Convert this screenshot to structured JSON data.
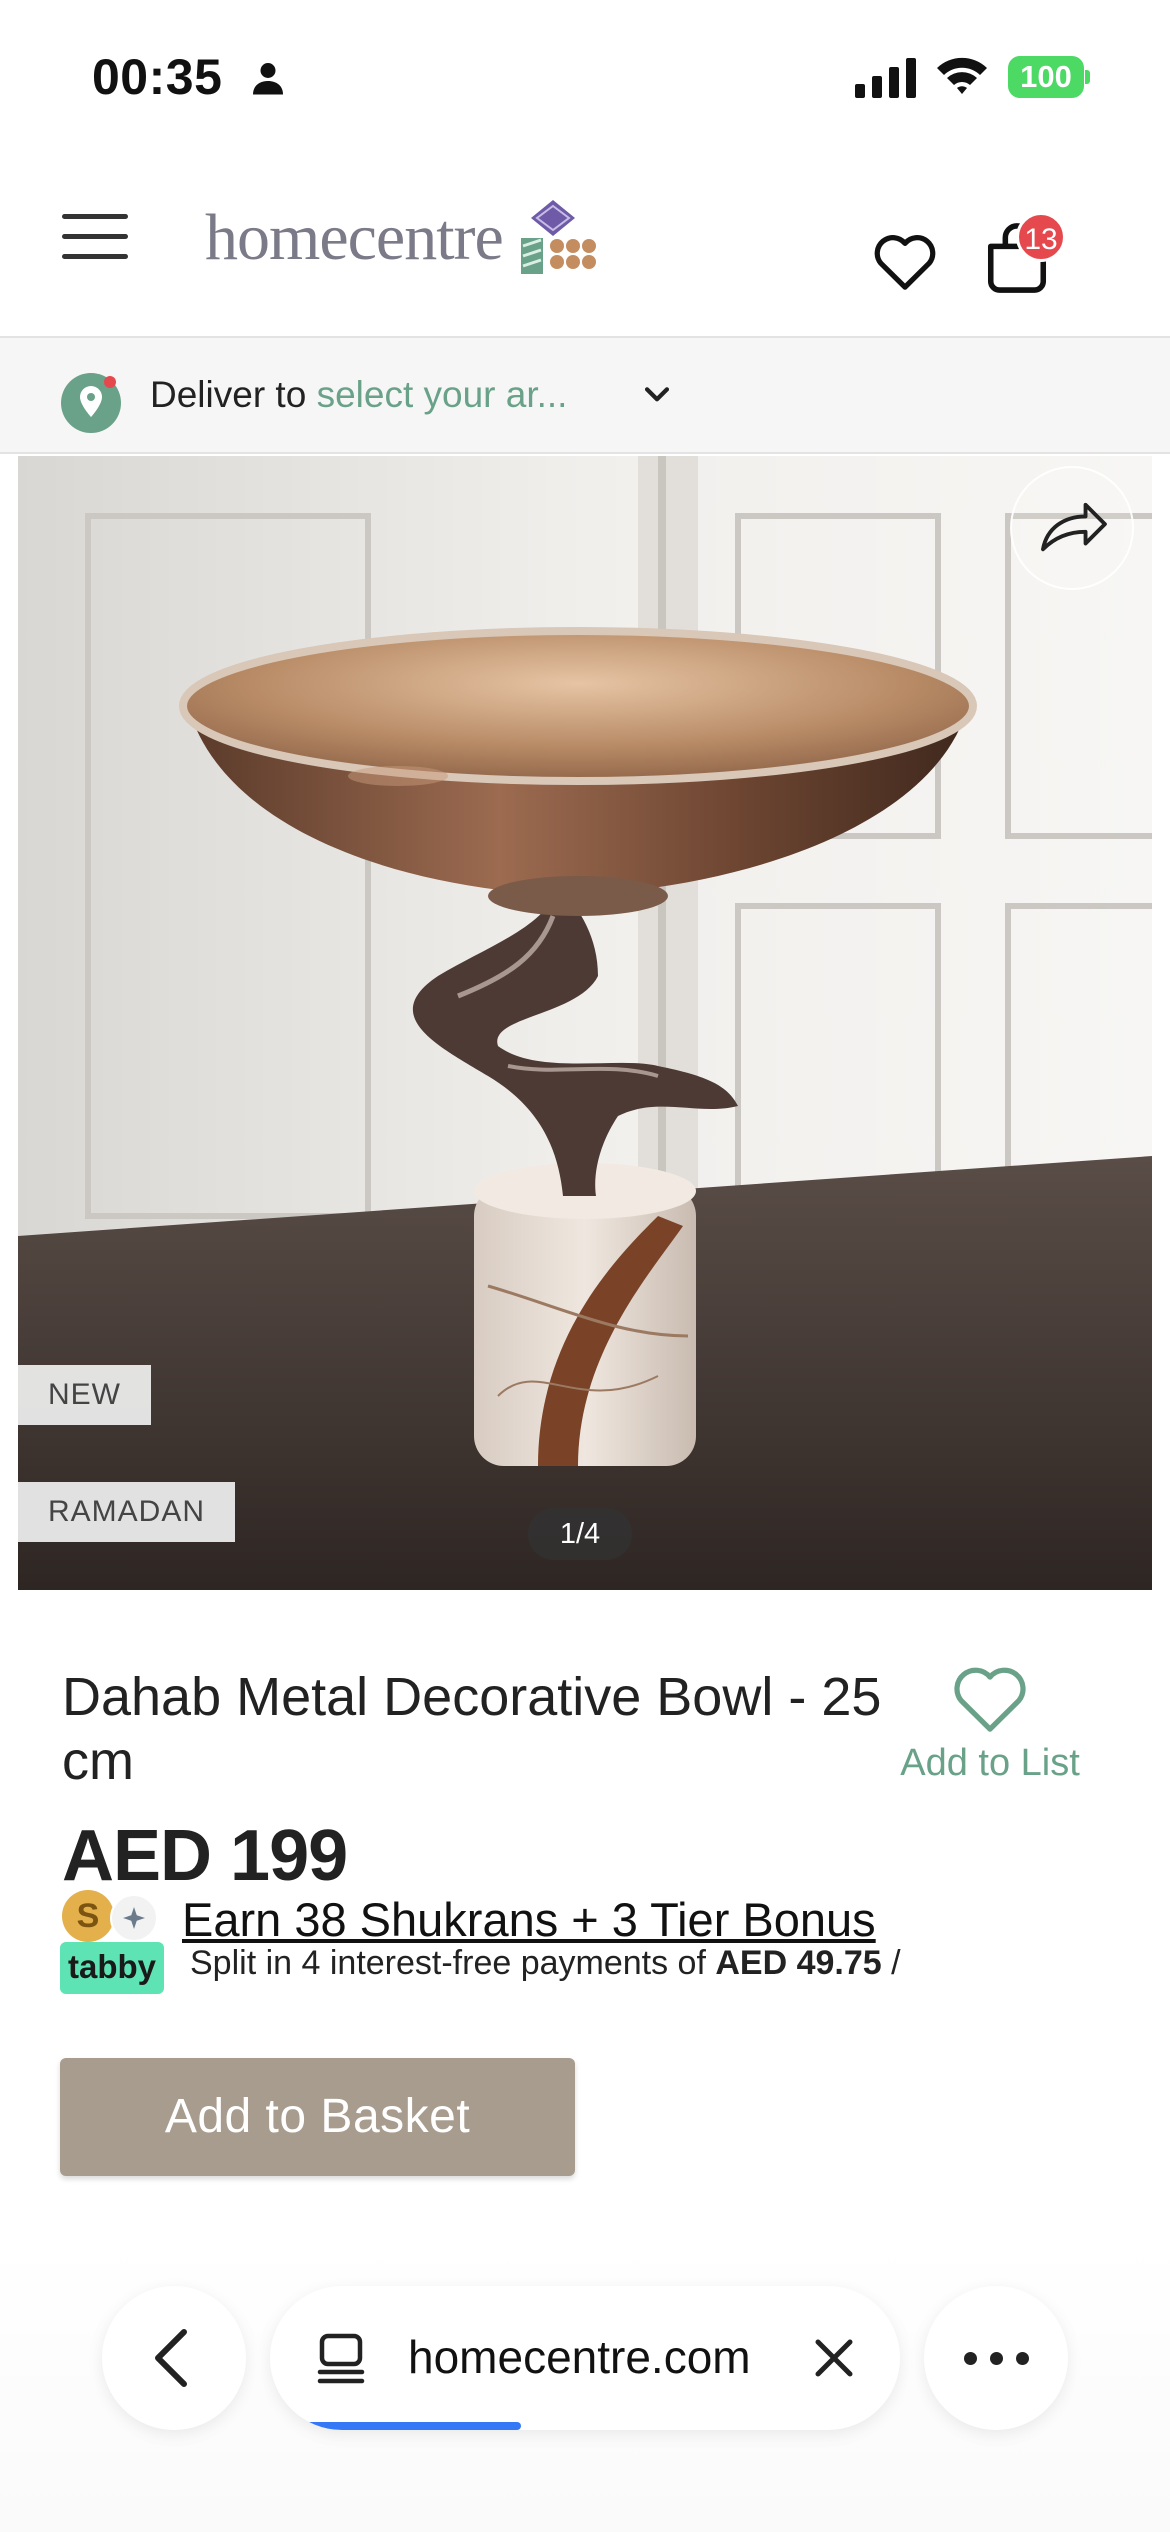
{
  "status_bar": {
    "time": "00:35",
    "battery": "100"
  },
  "header": {
    "logo_text": "homecentre",
    "cart_count": "13"
  },
  "deliver": {
    "prefix": "Deliver to",
    "location": "select your ar..."
  },
  "gallery": {
    "tags": [
      "NEW",
      "RAMADAN"
    ],
    "pager": "1/4"
  },
  "product": {
    "title": "Dahab Metal Decorative Bowl - 25 cm",
    "add_to_list": "Add to List",
    "price": "AED 199",
    "shukran_coin": "S",
    "shukran_text": "Earn 38 Shukrans +  3 Tier Bonus",
    "tabby_logo": "tabby",
    "tabby_text": "Split in 4 interest-free payments of",
    "tabby_amount": "AED 49.75",
    "tabby_suffix": " /",
    "add_to_basket": "Add to Basket"
  },
  "browser": {
    "url": "homecentre.com",
    "load_progress": 0.35
  },
  "colors": {
    "accent_green": "#6aa189",
    "basket_button": "#a89c8f",
    "badge_red": "#e5484d",
    "tabby_green": "#5ee3b4",
    "progress_blue": "#3478f6"
  },
  "icons": {
    "menu": "hamburger-icon",
    "wishlist": "heart-icon",
    "cart": "bag-icon",
    "location": "location-pin-icon",
    "share": "share-arrow-icon",
    "back": "chevron-left-icon",
    "tabs": "tabs-icon",
    "close": "close-icon",
    "more": "more-dots-icon"
  }
}
